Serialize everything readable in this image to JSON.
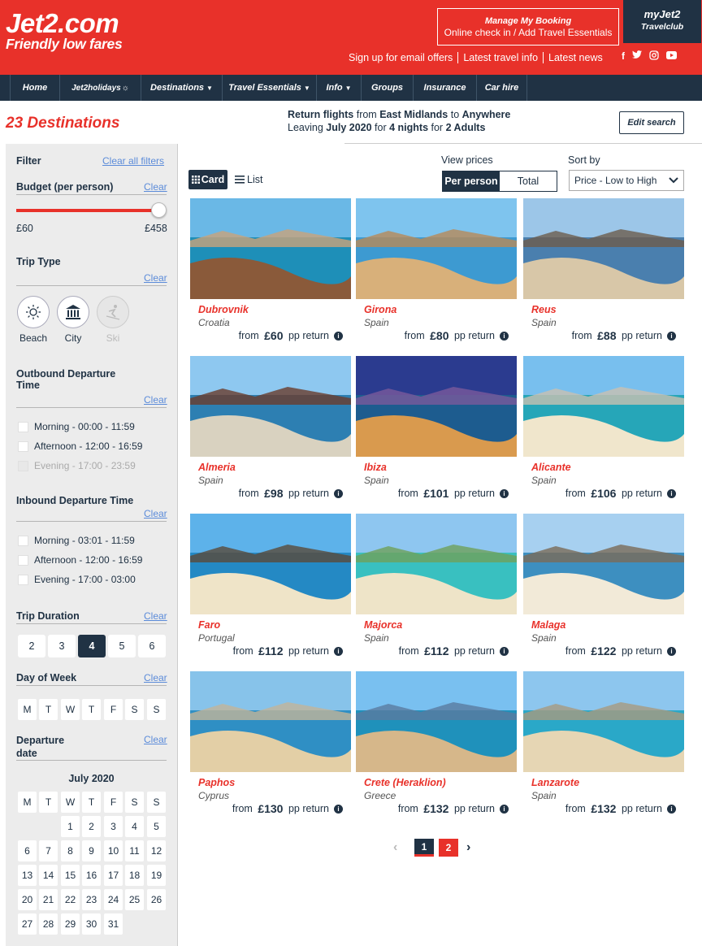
{
  "brand": {
    "name": "Jet2.com",
    "tagline": "Friendly low fares"
  },
  "header": {
    "manage_title": "Manage My Booking",
    "manage_sub": "Online check in / Add Travel Essentials",
    "myjet2_title": "myJet2",
    "myjet2_sub": "Travelclub",
    "links": [
      "Sign up for email offers",
      "Latest travel info",
      "Latest news"
    ]
  },
  "nav": [
    "Home",
    "Jet2holidays",
    "Destinations",
    "Travel Essentials",
    "Info",
    "Groups",
    "Insurance",
    "Car hire"
  ],
  "summary": {
    "count_label": "23 Destinations",
    "l1_a": "Return flights",
    "l1_b": " from ",
    "l1_c": "East Midlands",
    "l1_d": " to ",
    "l1_e": "Anywhere",
    "l2_a": "Leaving ",
    "l2_b": "July 2020",
    "l2_c": " for ",
    "l2_d": "4 nights",
    "l2_e": " for ",
    "l2_f": "2 Adults",
    "edit": "Edit search"
  },
  "filter": {
    "title": "Filter",
    "clear_all": "Clear all filters",
    "clear": "Clear",
    "budget": {
      "label": "Budget (per person)",
      "min": "£60",
      "max": "£458",
      "fill": 1.0
    },
    "trip_type": {
      "label": "Trip Type",
      "options": [
        "Beach",
        "City",
        "Ski"
      ]
    },
    "outbound": {
      "label_1": "Outbound Departure",
      "label_2": "Time",
      "options": [
        "Morning - 00:00 - 11:59",
        "Afternoon - 12:00 - 16:59",
        "Evening - 17:00 - 23:59"
      ]
    },
    "inbound": {
      "label": "Inbound Departure Time",
      "options": [
        "Morning - 03:01 - 11:59",
        "Afternoon - 12:00 - 16:59",
        "Evening - 17:00 - 03:00"
      ]
    },
    "duration": {
      "label": "Trip Duration",
      "options": [
        "2",
        "3",
        "4",
        "5",
        "6"
      ],
      "selected": "4"
    },
    "day_of_week": {
      "label": "Day of Week",
      "days": [
        "M",
        "T",
        "W",
        "T",
        "F",
        "S",
        "S"
      ]
    },
    "departure_date": {
      "label_1": "Departure",
      "label_2": "date",
      "month": "July 2020",
      "days": [
        "M",
        "T",
        "W",
        "T",
        "F",
        "S",
        "S"
      ],
      "dates": [
        "1",
        "2",
        "3",
        "4",
        "5",
        "6",
        "7",
        "8",
        "9",
        "10",
        "11",
        "12",
        "13",
        "14",
        "15",
        "16",
        "17",
        "18",
        "19",
        "20",
        "21",
        "22",
        "23",
        "24",
        "25",
        "26",
        "27",
        "28",
        "29",
        "30",
        "31"
      ]
    }
  },
  "view": {
    "card": "Card",
    "list": "List",
    "prices_label": "View prices",
    "per_person": "Per person",
    "total": "Total",
    "sort_label": "Sort by",
    "sort_value": "Price - Low to High"
  },
  "destinations": [
    {
      "name": "Dubrovnik",
      "country": "Croatia",
      "price": "£60"
    },
    {
      "name": "Girona",
      "country": "Spain",
      "price": "£80"
    },
    {
      "name": "Reus",
      "country": "Spain",
      "price": "£88"
    },
    {
      "name": "Almeria",
      "country": "Spain",
      "price": "£98"
    },
    {
      "name": "Ibiza",
      "country": "Spain",
      "price": "£101"
    },
    {
      "name": "Alicante",
      "country": "Spain",
      "price": "£106"
    },
    {
      "name": "Faro",
      "country": "Portugal",
      "price": "£112"
    },
    {
      "name": "Majorca",
      "country": "Spain",
      "price": "£112"
    },
    {
      "name": "Malaga",
      "country": "Spain",
      "price": "£122"
    },
    {
      "name": "Paphos",
      "country": "Cyprus",
      "price": "£130"
    },
    {
      "name": "Crete (Heraklion)",
      "country": "Greece",
      "price": "£132"
    },
    {
      "name": "Lanzarote",
      "country": "Spain",
      "price": "£132"
    }
  ],
  "price_prefix": "from ",
  "price_suffix": " pp return",
  "pagination": {
    "pages": [
      "1",
      "2"
    ],
    "current": "1"
  },
  "colors": {
    "brand_red": "#e8312a",
    "navy": "#203244",
    "link_blue": "#5b8bd9"
  }
}
